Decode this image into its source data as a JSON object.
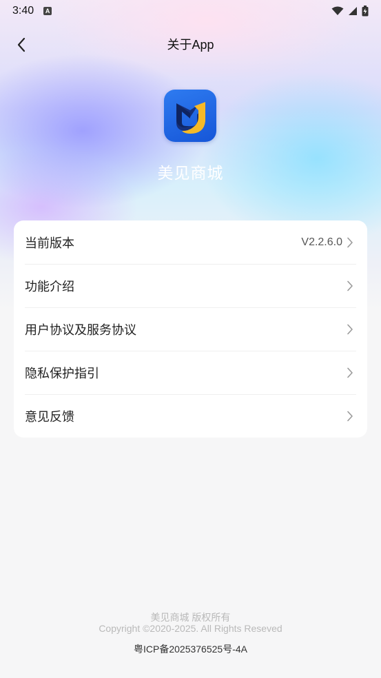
{
  "status_bar": {
    "time": "3:40",
    "notification_icon": "A",
    "icons": [
      "wifi-icon",
      "signal-icon",
      "battery-icon"
    ]
  },
  "nav": {
    "title": "关于App",
    "back_icon": "chevron-left-icon"
  },
  "app": {
    "name": "美见商城",
    "logo_icon": "app-logo-icon",
    "colors": {
      "logo_bg": "#1f66e6",
      "logo_accent": "#f5b928",
      "logo_dark": "#16307a"
    }
  },
  "menu": [
    {
      "label": "当前版本",
      "value": "V2.2.6.0"
    },
    {
      "label": "功能介绍"
    },
    {
      "label": "用户协议及服务协议"
    },
    {
      "label": "隐私保护指引"
    },
    {
      "label": "意见反馈"
    }
  ],
  "footer": {
    "line1": "美见商城 版权所有",
    "line2": "Copyright ©2020-2025. All Rights Reseved",
    "icp": "粤ICP备2025376525号-4A"
  }
}
